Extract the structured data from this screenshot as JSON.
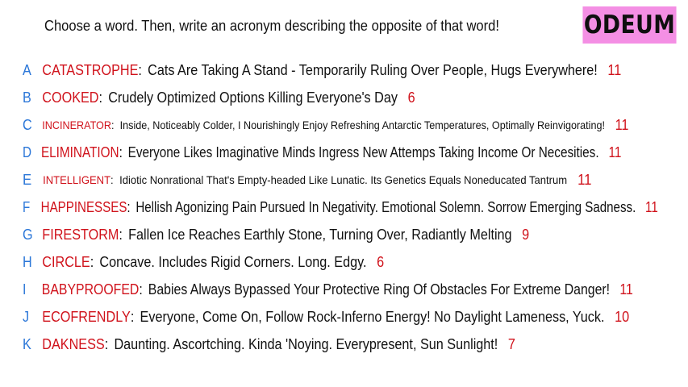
{
  "prompt": "Choose a word. Then, write an acronym describing the opposite of that word!",
  "badge": "ODEUM",
  "entries": [
    {
      "letter": "A",
      "word": "CATASTROPHE",
      "acronym": "Cats Are Taking A Stand - Temporarily Ruling Over People, Hugs Everywhere!",
      "count": "11"
    },
    {
      "letter": "B",
      "word": "COOKED",
      "acronym": "Crudely Optimized Options Killing Everyone's Day",
      "count": "6"
    },
    {
      "letter": "C",
      "word": "INCINERATOR",
      "acronym": "Inside, Noticeably Colder, I Nourishingly Enjoy Refreshing Antarctic Temperatures, Optimally Reinvigorating!",
      "count": "11"
    },
    {
      "letter": "D",
      "word": "ELIMINATION",
      "acronym": "Everyone Likes Imaginative Minds Ingress New Attemps Taking Income Or Necesities.",
      "count": "11"
    },
    {
      "letter": "E",
      "word": "INTELLIGENT",
      "acronym": "Idiotic Nonrational That's Empty-headed Like Lunatic. Its Genetics Equals Noneducated Tantrum",
      "count": "11"
    },
    {
      "letter": "F",
      "word": "HAPPINESSES",
      "acronym": "Hellish Agonizing Pain Pursued In Negativity. Emotional Solemn. Sorrow Emerging Sadness.",
      "count": "11"
    },
    {
      "letter": "G",
      "word": "FIRESTORM",
      "acronym": "Fallen Ice Reaches Earthly Stone, Turning Over, Radiantly Melting",
      "count": "9"
    },
    {
      "letter": "H",
      "word": "CIRCLE",
      "acronym": "Concave. Includes Rigid Corners. Long. Edgy.",
      "count": "6"
    },
    {
      "letter": "I",
      "word": "BABYPROOFED",
      "acronym": "Babies Always Bypassed Your Protective Ring Of  Obstacles For Extreme Danger!",
      "count": "11"
    },
    {
      "letter": "J",
      "word": "ECOFRENDLY",
      "acronym": "Everyone, Come On, Follow Rock-Inferno Energy! No Daylight Lameness, Yuck.",
      "count": "10"
    },
    {
      "letter": "K",
      "word": "DAKNESS",
      "acronym": "Daunting. Ascortching. Kinda 'Noying. Everypresent, Sun Sunlight!",
      "count": "7"
    }
  ]
}
